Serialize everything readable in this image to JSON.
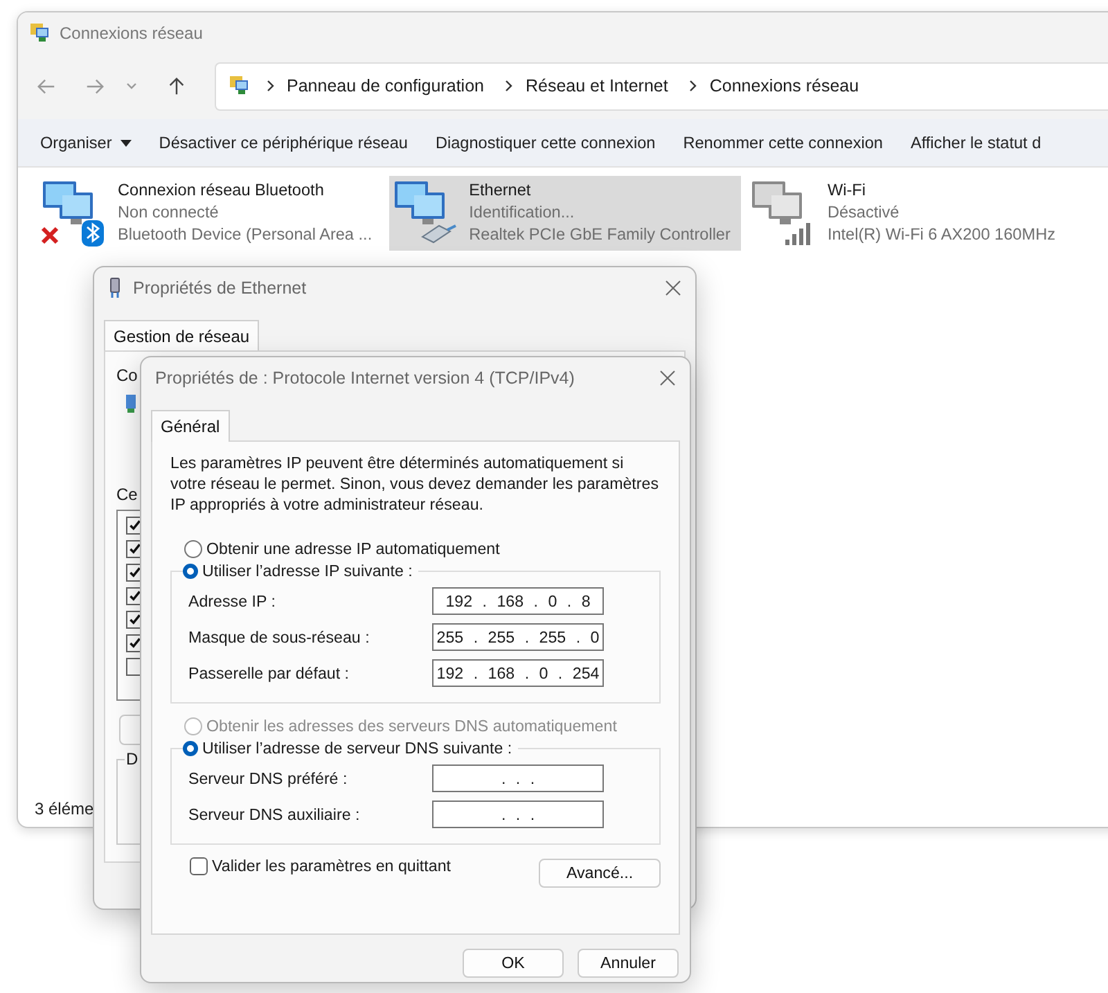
{
  "explorer": {
    "title": "Connexions réseau",
    "breadcrumb": [
      "Panneau de configuration",
      "Réseau et Internet",
      "Connexions réseau"
    ],
    "commands": [
      {
        "label": "Organiser",
        "kind": "menu"
      },
      {
        "label": "Désactiver ce périphérique réseau",
        "kind": "action"
      },
      {
        "label": "Diagnostiquer cette connexion",
        "kind": "action"
      },
      {
        "label": "Renommer cette connexion",
        "kind": "action"
      },
      {
        "label": "Afficher le statut d",
        "kind": "action"
      }
    ],
    "connections": [
      {
        "name": "Connexion réseau Bluetooth",
        "status": "Non connecté",
        "device": "Bluetooth Device (Personal Area ...",
        "kind": "bluetooth",
        "selected": false
      },
      {
        "name": "Ethernet",
        "status": "Identification...",
        "device": "Realtek PCIe GbE Family Controller",
        "kind": "ethernet",
        "selected": true
      },
      {
        "name": "Wi-Fi",
        "status": "Désactivé",
        "device": "Intel(R) Wi-Fi 6 AX200 160MHz",
        "kind": "wifi",
        "selected": false
      }
    ],
    "status_bar": "3 éléme"
  },
  "ethernet_dialog": {
    "title": "Propriétés de Ethernet",
    "tabs": [
      {
        "label": "Gestion de réseau",
        "selected": true
      }
    ],
    "label_1": "Co",
    "label_2": "Ce",
    "components": [
      {
        "checked": true
      },
      {
        "checked": true
      },
      {
        "checked": true
      },
      {
        "checked": true
      },
      {
        "checked": true
      },
      {
        "checked": true
      },
      {
        "checked": false
      }
    ],
    "group_label": "D"
  },
  "ipv4_dialog": {
    "title": "Propriétés de : Protocole Internet version 4 (TCP/IPv4)",
    "tabs": [
      {
        "label": "Général",
        "selected": true
      }
    ],
    "intro": "Les paramètres IP peuvent être déterminés automatiquement si votre réseau le permet. Sinon, vous devez demander les paramètres IP appropriés à votre administrateur réseau.",
    "ip_modes": [
      {
        "label": "Obtenir une adresse IP automatiquement",
        "selected": false,
        "disabled": false
      },
      {
        "label": "Utiliser l’adresse IP suivante :",
        "selected": true,
        "disabled": false
      }
    ],
    "ip_fields": [
      {
        "label": "Adresse IP :",
        "value": "192 . 168 . 0 . 8"
      },
      {
        "label": "Masque de sous-réseau :",
        "value": "255 . 255 . 255 . 0"
      },
      {
        "label": "Passerelle par défaut :",
        "value": "192 . 168 . 0 . 254"
      }
    ],
    "dns_modes": [
      {
        "label": "Obtenir les adresses des serveurs DNS automatiquement",
        "selected": false,
        "disabled": true
      },
      {
        "label": "Utiliser l’adresse de serveur DNS suivante :",
        "selected": true,
        "disabled": false
      }
    ],
    "dns_fields": [
      {
        "label": "Serveur DNS préféré :",
        "value": ". . ."
      },
      {
        "label": "Serveur DNS auxiliaire :",
        "value": ". . ."
      }
    ],
    "validate": {
      "label": "Valider les paramètres en quittant",
      "checked": false
    },
    "advanced_button": "Avancé...",
    "buttons": [
      "OK",
      "Annuler"
    ]
  }
}
